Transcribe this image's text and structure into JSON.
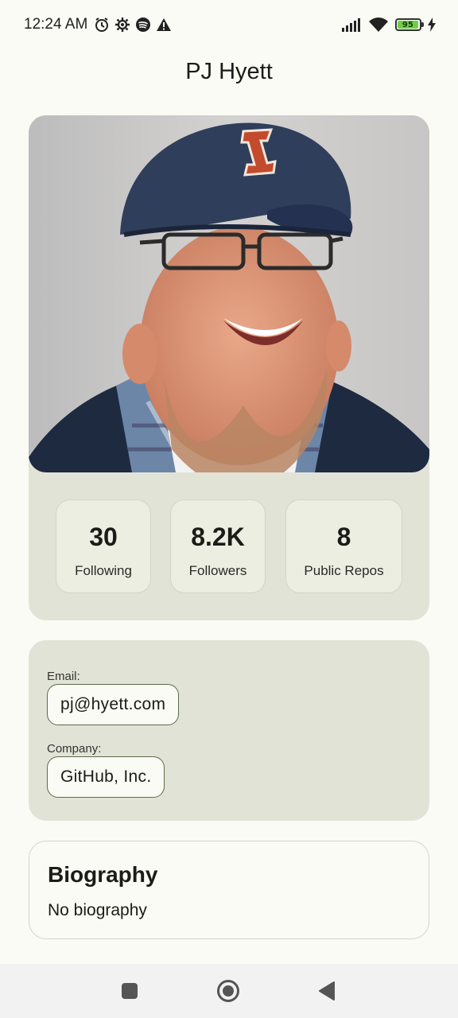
{
  "status_bar": {
    "time": "12:24 AM",
    "left_icons": [
      "alarm-icon",
      "settings-gear-icon",
      "spotify-icon",
      "warning-icon"
    ],
    "right_icons": [
      "signal-icon",
      "wifi-icon",
      "battery-icon",
      "charging-icon"
    ],
    "battery_level": "95",
    "battery_fraction": 0.95
  },
  "header": {
    "title": "PJ Hyett"
  },
  "profile": {
    "stats": [
      {
        "value": "30",
        "label": "Following"
      },
      {
        "value": "8.2K",
        "label": "Followers"
      },
      {
        "value": "8",
        "label": "Public Repos"
      }
    ]
  },
  "contact": {
    "email_label": "Email:",
    "email_value": "pj@hyett.com",
    "company_label": "Company:",
    "company_value": "GitHub, Inc."
  },
  "biography": {
    "title": "Biography",
    "text": "No biography"
  },
  "nav_bar": {
    "buttons": [
      "recents-button",
      "home-button",
      "back-button"
    ]
  },
  "colors": {
    "background": "#fbfbf5",
    "card": "#e2e3d7",
    "stat_box": "#eceee2",
    "chip_border": "#5b6b4a",
    "battery": "#6fcf4a"
  }
}
